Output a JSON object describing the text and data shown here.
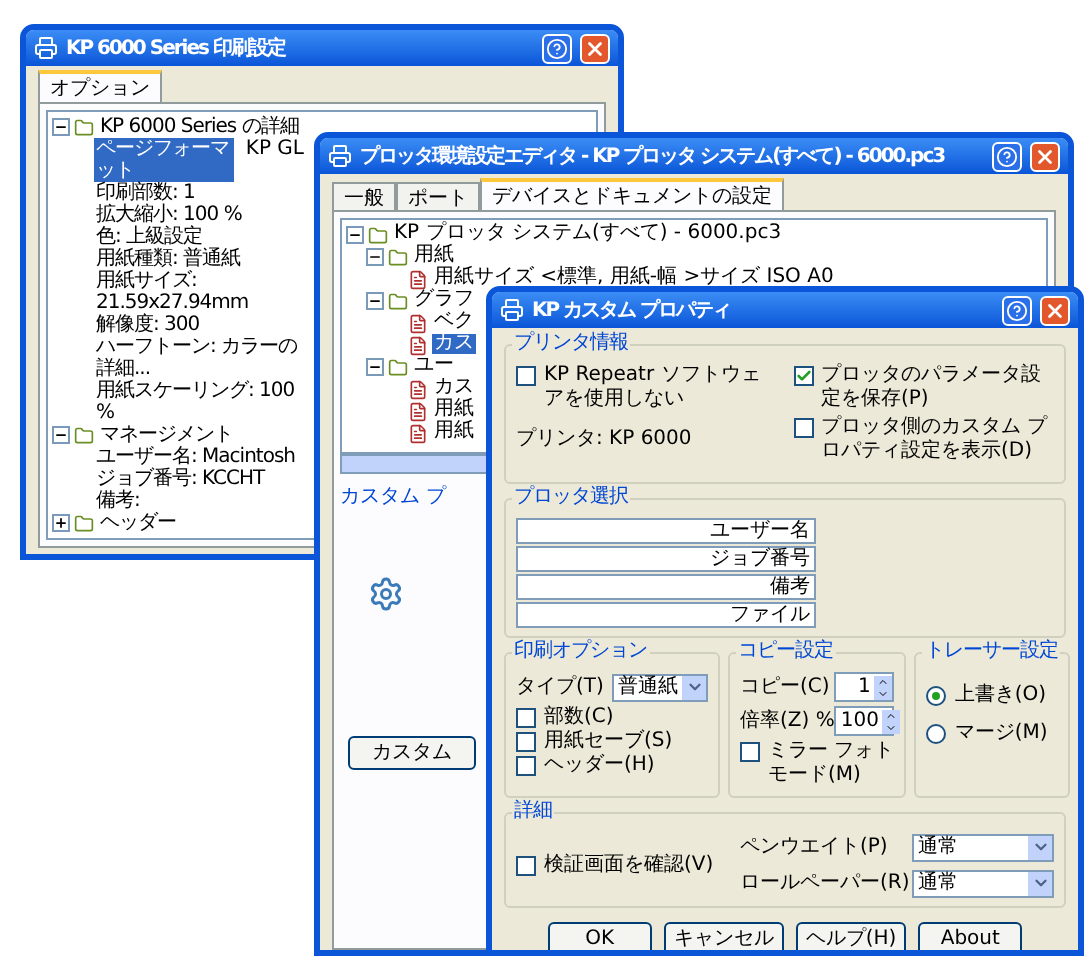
{
  "print_settings_window": {
    "title": "KP 6000 Series 印刷設定",
    "tabs": [
      {
        "label": "オプション",
        "selected": true
      }
    ],
    "tree": [
      {
        "label": "KP 6000 Series の詳細",
        "expanded": true,
        "selected": false,
        "children": [
          {
            "label": "ページフォーマット",
            "value": "KP GL",
            "selected": true
          },
          {
            "label": "印刷部数: 1",
            "selected": false
          },
          {
            "label": "拡大縮小: 100 %",
            "selected": false
          },
          {
            "label": "色: 上級設定",
            "selected": false
          },
          {
            "label": "用紙種類: 普通紙",
            "selected": false
          },
          {
            "label": "用紙サイズ: 21.59x27.94mm",
            "selected": false
          },
          {
            "label": "解像度: 300",
            "selected": false
          },
          {
            "label": "ハーフトーン: カラーの詳細...",
            "selected": false
          },
          {
            "label": "用紙スケーリング: 100 %",
            "selected": false
          }
        ]
      },
      {
        "label": "マネージメント",
        "expanded": true,
        "selected": false,
        "children": [
          {
            "label": "ユーザー名: Macintosh",
            "selected": false
          },
          {
            "label": "ジョブ番号: KCCHT",
            "selected": false
          },
          {
            "label": "備考:",
            "selected": false
          }
        ]
      },
      {
        "label": "ヘッダー",
        "expanded": false,
        "selected": false
      }
    ]
  },
  "plotter_editor_window": {
    "title": "プロッタ環境設定エディタ - KP プロッタ システム(すべて) - 6000.pc3",
    "tabs": [
      {
        "label": "一般",
        "selected": false
      },
      {
        "label": "ポート",
        "selected": false
      },
      {
        "label": "デバイスとドキュメントの設定",
        "selected": true
      }
    ],
    "tree": [
      {
        "label": "KP プロッタ システム(すべて) - 6000.pc3",
        "expanded": true,
        "selected": false,
        "children": [
          {
            "label": "用紙",
            "expanded": true,
            "selected": false,
            "children": [
              {
                "label": "用紙サイズ <標準, 用紙-幅 >サイズ ISO A0",
                "selected": false
              }
            ]
          },
          {
            "label": "グラフ",
            "expanded": true,
            "selected": false,
            "children": [
              {
                "label": "ベク",
                "selected": false
              },
              {
                "label": "カス",
                "selected": true
              }
            ]
          },
          {
            "label": "ユー",
            "expanded": true,
            "selected": false,
            "children": [
              {
                "label": "カス",
                "selected": false
              },
              {
                "label": "用紙",
                "selected": false
              },
              {
                "label": "用紙",
                "selected": false
              }
            ]
          }
        ]
      }
    ],
    "description": "カスタム プ",
    "custom_button": "カスタム"
  },
  "custom_properties_window": {
    "title": "KP カスタム プロパティ",
    "printer_info": {
      "legend": "プリンタ情報",
      "options": [
        {
          "label": "KP Repeatr ソフトウェアを使用しない",
          "checked": false
        },
        {
          "label": "プロッタのパラメータ設定を保存(P)",
          "checked": true
        },
        {
          "label": "プロッタ側のカスタム プロパティ設定を表示(D)",
          "checked": false
        }
      ],
      "printer": "プリンタ: KP 6000"
    },
    "plotter_select": {
      "legend": "プロッタ選択",
      "fields": [
        "ユーザー名",
        "ジョブ番号",
        "備考",
        "ファイル"
      ]
    },
    "print_options": {
      "legend": "印刷オプション",
      "type_label": "タイプ(T)",
      "type_value": "普通紙",
      "options": [
        {
          "label": "部数(C)",
          "checked": false
        },
        {
          "label": "用紙セーブ(S)",
          "checked": false
        },
        {
          "label": "ヘッダー(H)",
          "checked": false
        }
      ]
    },
    "copy_settings": {
      "legend": "コピー設定",
      "copies_label": "コピー(C)",
      "copies": "1",
      "scale_label": "倍率(Z) %",
      "scale": "100",
      "mirror": {
        "label": "ミラー フォトモード(M)",
        "checked": false
      }
    },
    "tracer_settings": {
      "legend": "トレーサー設定",
      "modes": [
        {
          "label": "上書き(O)",
          "selected": true
        },
        {
          "label": "マージ(M)",
          "selected": false
        }
      ]
    },
    "details": {
      "legend": "詳細",
      "verify": {
        "label": "検証画面を確認(V)",
        "checked": false
      },
      "pen_label": "ペンウエイト(P)",
      "pen_value": "通常",
      "roll_label": "ロールペーパー(R)",
      "roll_value": "通常"
    },
    "buttons": [
      "OK",
      "キャンセル",
      "ヘルプ(H)",
      "About"
    ]
  }
}
